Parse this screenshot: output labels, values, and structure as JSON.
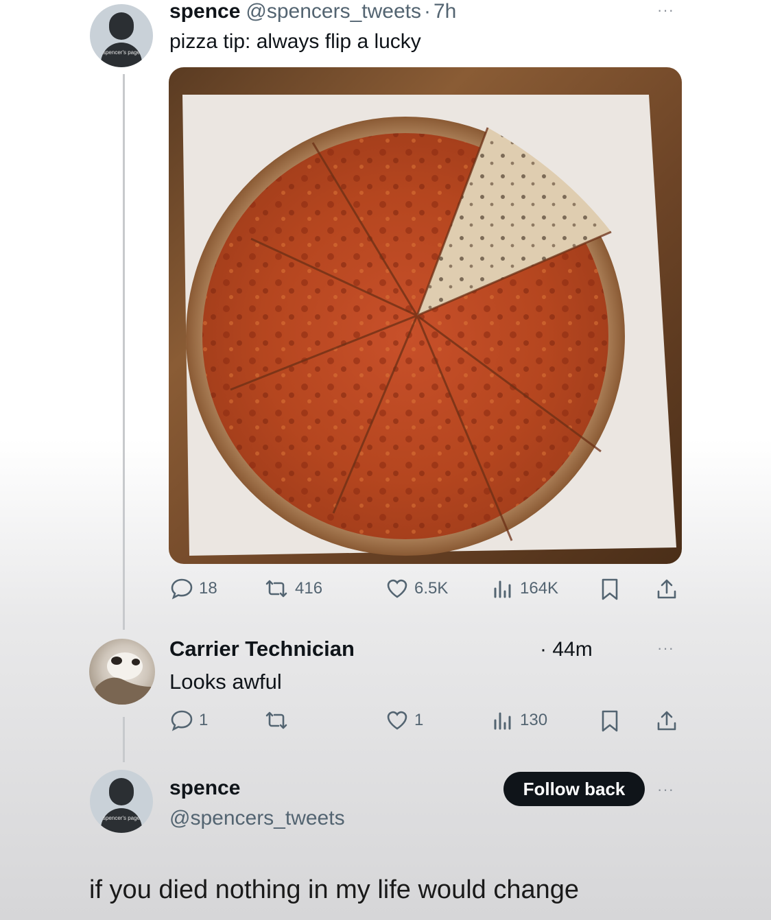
{
  "tweet": {
    "author_name": "spence",
    "author_handle": "@spencers_tweets",
    "separator": "·",
    "time": "7h",
    "text": "pizza tip: always flip a lucky",
    "avatar_tag": "spencer's page",
    "stats": {
      "replies": "18",
      "reposts": "416",
      "likes": "6.5K",
      "views": "164K"
    }
  },
  "reply": {
    "author_name": "Carrier Technician",
    "time": "· 44m",
    "text": "Looks awful",
    "stats": {
      "replies": "1",
      "reposts": "",
      "likes": "1",
      "views": "130"
    }
  },
  "profile_card": {
    "name": "spence",
    "handle": "@spencers_tweets",
    "follow_label": "Follow back",
    "avatar_tag": "spencer's page"
  },
  "caption": "if you died nothing in my life would change",
  "more_glyph": "···",
  "colors": {
    "text": "#0f1419",
    "muted": "#536471",
    "button_bg": "#0f1419",
    "thread_line": "#c7c9cc"
  },
  "icons": [
    "comment-icon",
    "repost-icon",
    "heart-icon",
    "views-icon",
    "bookmark-icon",
    "share-icon"
  ]
}
